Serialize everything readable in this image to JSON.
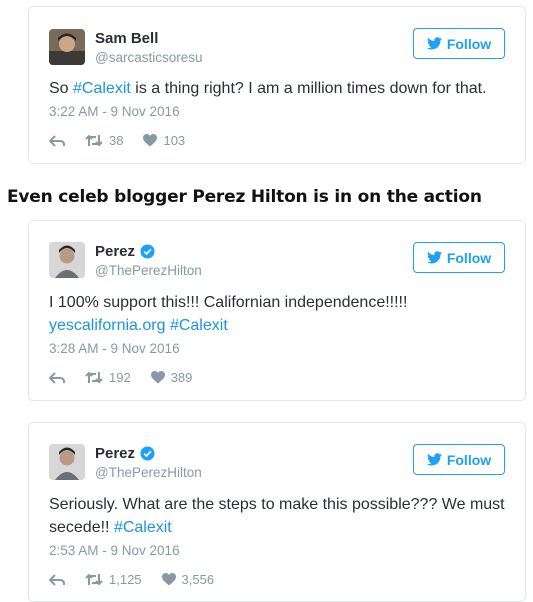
{
  "colors": {
    "link": "#1b95e0",
    "follow": "#1da1f2",
    "muted": "#8899a6",
    "verified": "#1da1f2"
  },
  "heading": "Even celeb blogger Perez Hilton is in on the action",
  "tweets": [
    {
      "name": "Sam Bell",
      "handle": "@sarcasticsoresu",
      "verified": false,
      "follow_label": "Follow",
      "text_before": "So ",
      "hashtag": "#Calexit",
      "text_after": " is a thing right? I am a million times down for that.",
      "time": "3:22 AM - 9 Nov 2016",
      "retweets": "38",
      "likes": "103"
    },
    {
      "name": "Perez",
      "handle": "@ThePerezHilton",
      "verified": true,
      "follow_label": "Follow",
      "text_line1": "I 100% support this!!! Californian independence!!!!!",
      "link": "yescalifornia.org",
      "hashtag": "#Calexit",
      "time": "3:28 AM - 9 Nov 2016",
      "retweets": "192",
      "likes": "389"
    },
    {
      "name": "Perez",
      "handle": "@ThePerezHilton",
      "verified": true,
      "follow_label": "Follow",
      "text_before": "Seriously. What are the steps to make this possible??? We must secede!! ",
      "hashtag": "#Calexit",
      "time": "2:53 AM - 9 Nov 2016",
      "retweets": "1,125",
      "likes": "3,556"
    }
  ]
}
